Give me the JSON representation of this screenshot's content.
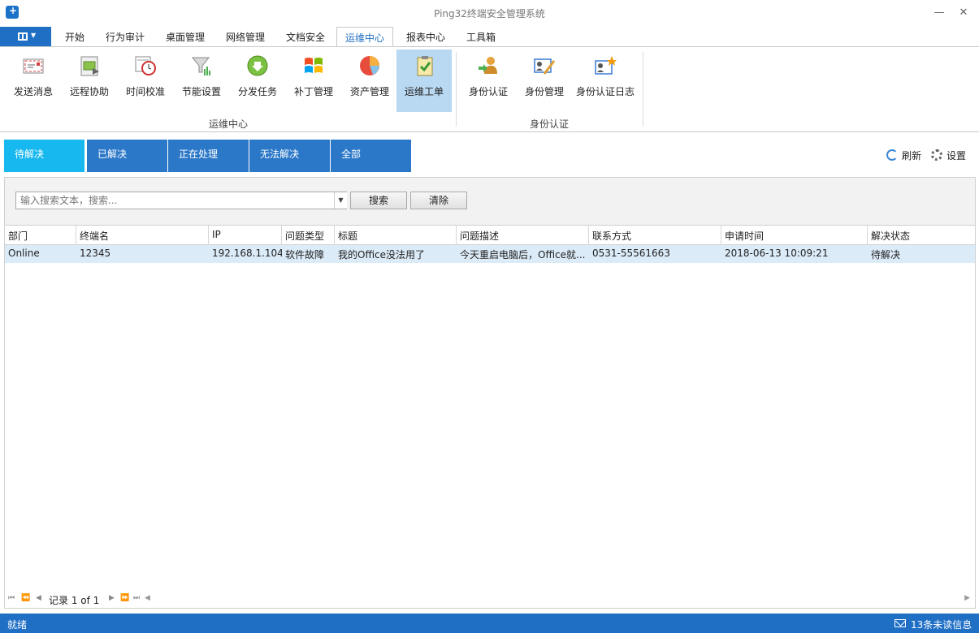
{
  "window": {
    "title": "Ping32终端安全管理系统"
  },
  "ribbon_tabs": [
    "开始",
    "行为审计",
    "桌面管理",
    "网络管理",
    "文档安全",
    "运维中心",
    "报表中心",
    "工具箱"
  ],
  "active_tab": "运维中心",
  "ribbon_groups": [
    {
      "label": "运维中心",
      "items": [
        "发送消息",
        "远程协助",
        "时间校准",
        "节能设置",
        "分发任务",
        "补丁管理",
        "资产管理",
        "运维工单"
      ]
    },
    {
      "label": "身份认证",
      "items": [
        "身份认证",
        "身份管理",
        "身份认证日志"
      ]
    }
  ],
  "selected_ribbon_item": "运维工单",
  "status_tabs": [
    "待解决",
    "已解决",
    "正在处理",
    "无法解决",
    "全部"
  ],
  "active_status_tab": "待解决",
  "toolbar": {
    "refresh": "刷新",
    "settings": "设置"
  },
  "search": {
    "placeholder": "输入搜索文本，搜索...",
    "search_label": "搜索",
    "clear_label": "清除"
  },
  "table": {
    "columns": [
      "部门",
      "终端名",
      "IP",
      "问题类型",
      "标题",
      "问题描述",
      "联系方式",
      "申请时间",
      "解决状态"
    ],
    "rows": [
      [
        "Online",
        "12345",
        "192.168.1.104",
        "软件故障",
        "我的Office没法用了",
        "今天重启电脑后，Office就...",
        "0531-55561663",
        "2018-06-13 10:09:21",
        "待解决"
      ]
    ]
  },
  "pager": {
    "record_text": "记录 1 of 1"
  },
  "statusbar": {
    "status": "就绪",
    "messages": "13条未读信息"
  },
  "colors": {
    "accent": "#1f6fc5",
    "tab_active": "#17b8ef",
    "tab": "#2c78c8",
    "row_selected": "#dcebf8",
    "ribbon_selected": "#b9d8f1"
  }
}
